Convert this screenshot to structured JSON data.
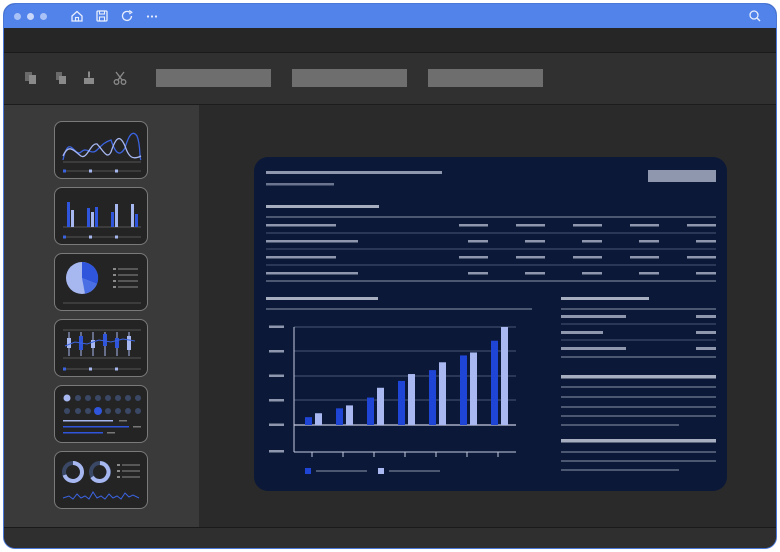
{
  "window": {
    "accent": "#5283ea",
    "titlebar_icons": [
      "home-icon",
      "save-icon",
      "refresh-icon",
      "more-icon",
      "search-icon"
    ]
  },
  "toolbar": {
    "icons": [
      "copy-icon",
      "paste-icon",
      "format-painter-icon",
      "cut-icon"
    ]
  },
  "sidebar": {
    "thumbnails": [
      "line-chart",
      "bar-chart",
      "pie-chart",
      "candlestick-chart",
      "dot-matrix",
      "donut-charts"
    ]
  },
  "document": {
    "background": "#0b1838",
    "bar_colors": [
      "#1f45d6",
      "#a9b8f0"
    ],
    "chart_data": {
      "type": "bar",
      "series": [
        {
          "values": [
            0.08,
            0.17,
            0.28,
            0.45,
            0.56,
            0.71
          ]
        },
        {
          "values": [
            0.12,
            0.2,
            0.38,
            0.52,
            0.64,
            0.74
          ]
        }
      ],
      "extra": [
        0.86,
        1.0
      ]
    }
  }
}
